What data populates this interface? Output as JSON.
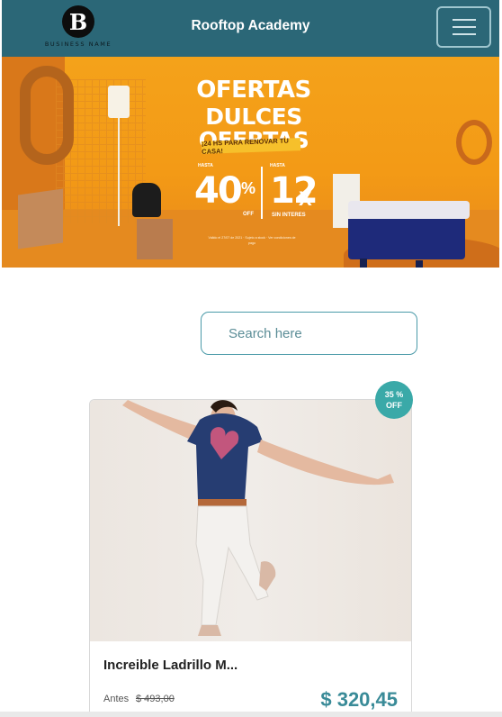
{
  "header": {
    "logo_letter": "B",
    "logo_text": "BUSINESS NAME",
    "title": "Rooftop Academy",
    "menu_icon": "hamburger-menu-icon"
  },
  "banner": {
    "line1": "OFERTAS",
    "line2": "DULCES OFERTAS",
    "tagline": "¡24 HS PARA RENOVAR TU CASA!",
    "hasta_left": "HASTA",
    "discount": "40",
    "percent": "%",
    "off": "OFF",
    "hasta_right": "HASTA",
    "installments": "12",
    "x": "X",
    "sin_interes": "SIN INTERES",
    "fine_print": "Válido el 27/07 de 2021 · Sujeto a stock · Ver condiciones de pago"
  },
  "search": {
    "placeholder": "Search here",
    "value": ""
  },
  "product": {
    "badge_pct": "35 %",
    "badge_off": "OFF",
    "name": "Increible Ladrillo M...",
    "before_label": "Antes",
    "before_price": "$ 493,00",
    "price": "$ 320,45"
  },
  "colors": {
    "navbar": "#2b6777",
    "accent": "#3a8b98",
    "badge": "#3aa9a8",
    "banner": "#f39a16"
  }
}
